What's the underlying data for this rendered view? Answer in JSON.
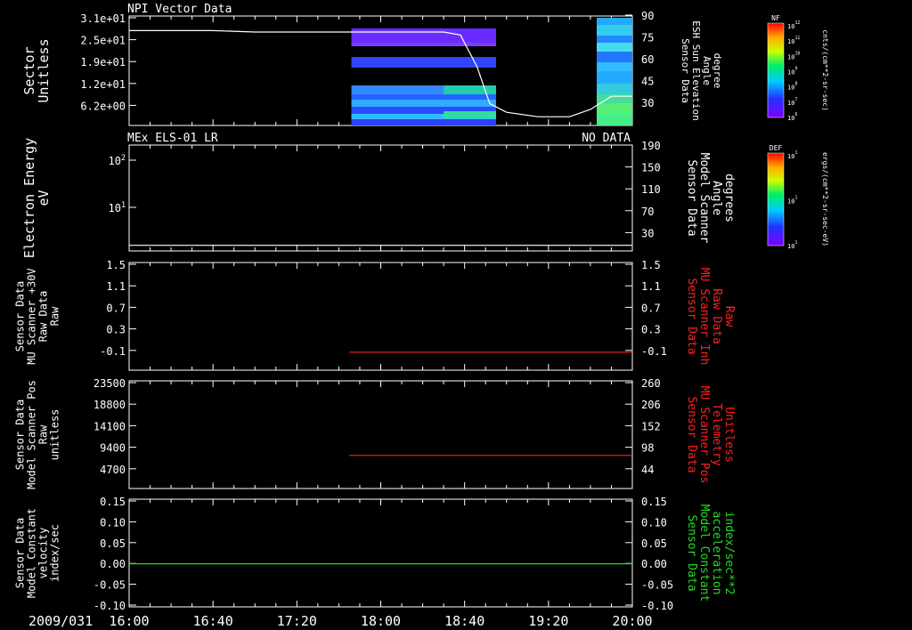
{
  "date_label": "2009/031",
  "time_ticks": [
    "16:00",
    "16:40",
    "17:20",
    "18:00",
    "18:40",
    "19:20",
    "20:00"
  ],
  "colors": {
    "white": "#ffffff",
    "red": "#ff2020",
    "green": "#22dd22",
    "background": "#000000"
  },
  "panels": [
    {
      "id": "npi",
      "title_left": "NPI Vector Data",
      "title_right": "",
      "left_ticks": [
        "3.1e+01",
        "2.5e+01",
        "1.9e+01",
        "1.2e+01",
        "6.2e+00"
      ],
      "left_label": [
        "Sector",
        "Unitless"
      ],
      "right_ticks": [
        "90",
        "75",
        "60",
        "45",
        "30"
      ],
      "right_label": [
        "Sensor Data",
        "ESH Sun Elevation",
        "Angle",
        "degree"
      ],
      "right_label_color": "#ffffff"
    },
    {
      "id": "els",
      "title_left": "MEx ELS-01 LR",
      "title_right": "NO DATA",
      "left_ticks": [
        "10^2",
        "10^1"
      ],
      "left_label": [
        "Electron Energy",
        "eV"
      ],
      "right_ticks": [
        "190",
        "150",
        "110",
        "70",
        "30"
      ],
      "right_label": [
        "Sensor Data",
        "Model Scanner",
        "Angle",
        "degrees"
      ],
      "right_label_color": "#ffffff"
    },
    {
      "id": "mu_inh",
      "title_left": "",
      "title_right": "",
      "left_ticks": [
        "1.5",
        "1.1",
        "0.7",
        "0.3",
        "-0.1"
      ],
      "left_label": [
        "Sensor Data",
        "MU Scanner +30V",
        "Raw Data",
        "Raw"
      ],
      "right_ticks": [
        "1.5",
        "1.1",
        "0.7",
        "0.3",
        "-0.1"
      ],
      "right_label": [
        "Sensor Data",
        "MU Scanner Inh",
        "Raw Data",
        "Raw"
      ],
      "right_label_color": "#ff2020"
    },
    {
      "id": "scanner_pos",
      "title_left": "",
      "title_right": "",
      "left_ticks": [
        "23500",
        "18800",
        "14100",
        "9400",
        "4700"
      ],
      "left_label": [
        "Sensor Data",
        "Model Scanner Pos",
        "Raw",
        "unitless"
      ],
      "right_ticks": [
        "260",
        "206",
        "152",
        "98",
        "44"
      ],
      "right_label": [
        "Sensor Data",
        "MU Scanner Pos",
        "Telemetry",
        "Unitless"
      ],
      "right_label_color": "#ff2020"
    },
    {
      "id": "constant",
      "title_left": "",
      "title_right": "",
      "left_ticks": [
        "0.15",
        "0.10",
        "0.05",
        "0.00",
        "-0.05",
        "-0.10"
      ],
      "left_label": [
        "Sensor Data",
        "Model Constant",
        "velocity",
        "index/sec"
      ],
      "right_ticks": [
        "0.15",
        "0.10",
        "0.05",
        "0.00",
        "-0.05",
        "-0.10"
      ],
      "right_label": [
        "Sensor Data",
        "Model Constant",
        "acceleration",
        "index/sec**2"
      ],
      "right_label_color": "#22dd22"
    }
  ],
  "colorbars": [
    {
      "label": "NF",
      "units": "cnts/(cm**2-sr-sec)",
      "ticks": [
        "10^12",
        "10^11",
        "10^10",
        "10^9",
        "10^8",
        "10^7",
        "10^6"
      ]
    },
    {
      "label": "DEF",
      "units": "ergs/(cm**2-sr-sec-eV)",
      "ticks": [
        "10^1",
        "10^1",
        "10^1"
      ]
    }
  ],
  "chart_data": [
    {
      "type": "heatmap",
      "panel": "npi",
      "x_range": [
        "16:00",
        "20:00"
      ],
      "ylabel": "Sector Unitless",
      "y2label": "Sensor Data ESH Sun Elevation Angle degree",
      "ylim": [
        0,
        31
      ],
      "y2lim": [
        15,
        90
      ],
      "series": [
        {
          "name": "ESH Sun Elevation Angle",
          "axis": "right",
          "color": "#ffffff",
          "x": [
            "16:00",
            "16:40",
            "17:00",
            "17:40",
            "18:30",
            "18:38",
            "18:46",
            "18:52",
            "19:00",
            "19:15",
            "19:30",
            "19:40",
            "19:50",
            "20:00"
          ],
          "y": [
            80,
            80,
            79,
            79,
            79,
            77,
            55,
            30,
            24,
            21,
            21,
            26,
            35,
            35
          ]
        }
      ],
      "data_blocks": [
        {
          "x": [
            "17:46",
            "18:55"
          ],
          "note": "spectrogram data present"
        },
        {
          "x": [
            "19:43",
            "20:00"
          ],
          "note": "spectrogram data present"
        }
      ]
    },
    {
      "type": "line",
      "panel": "els",
      "x_range": [
        "16:00",
        "20:00"
      ],
      "ylabel": "Electron Energy eV",
      "y2label": "Sensor Data Model Scanner Angle degrees",
      "y_scale": "log",
      "y2lim": [
        0,
        190
      ],
      "series": [
        {
          "name": "Model Scanner Angle",
          "axis": "right",
          "color": "#ffffff",
          "x": [
            "16:00",
            "20:00"
          ],
          "y": [
            10,
            10
          ]
        }
      ]
    },
    {
      "type": "line",
      "panel": "mu_inh",
      "x_range": [
        "16:00",
        "20:00"
      ],
      "ylim": [
        -0.3,
        1.5
      ],
      "y2lim": [
        -0.3,
        1.5
      ],
      "series": [
        {
          "name": "MU Scanner Inh Raw Data",
          "axis": "right",
          "color": "#ff2020",
          "x": [
            "17:45",
            "20:00"
          ],
          "y": [
            0.0,
            0.0
          ]
        }
      ]
    },
    {
      "type": "line",
      "panel": "scanner_pos",
      "x_range": [
        "16:00",
        "20:00"
      ],
      "ylim": [
        0,
        23500
      ],
      "y2lim": [
        0,
        260
      ],
      "series": [
        {
          "name": "MU Scanner Pos Telemetry",
          "axis": "right",
          "color": "#ff2020",
          "x": [
            "17:45",
            "20:00"
          ],
          "y": [
            80,
            80
          ]
        }
      ]
    },
    {
      "type": "line",
      "panel": "constant",
      "x_range": [
        "16:00",
        "20:00"
      ],
      "ylim": [
        -0.1,
        0.15
      ],
      "y2lim": [
        -0.1,
        0.15
      ],
      "series": [
        {
          "name": "Model Constant velocity",
          "axis": "left",
          "color": "#22dd22",
          "x": [
            "16:00",
            "20:00"
          ],
          "y": [
            0,
            0
          ]
        }
      ]
    }
  ]
}
